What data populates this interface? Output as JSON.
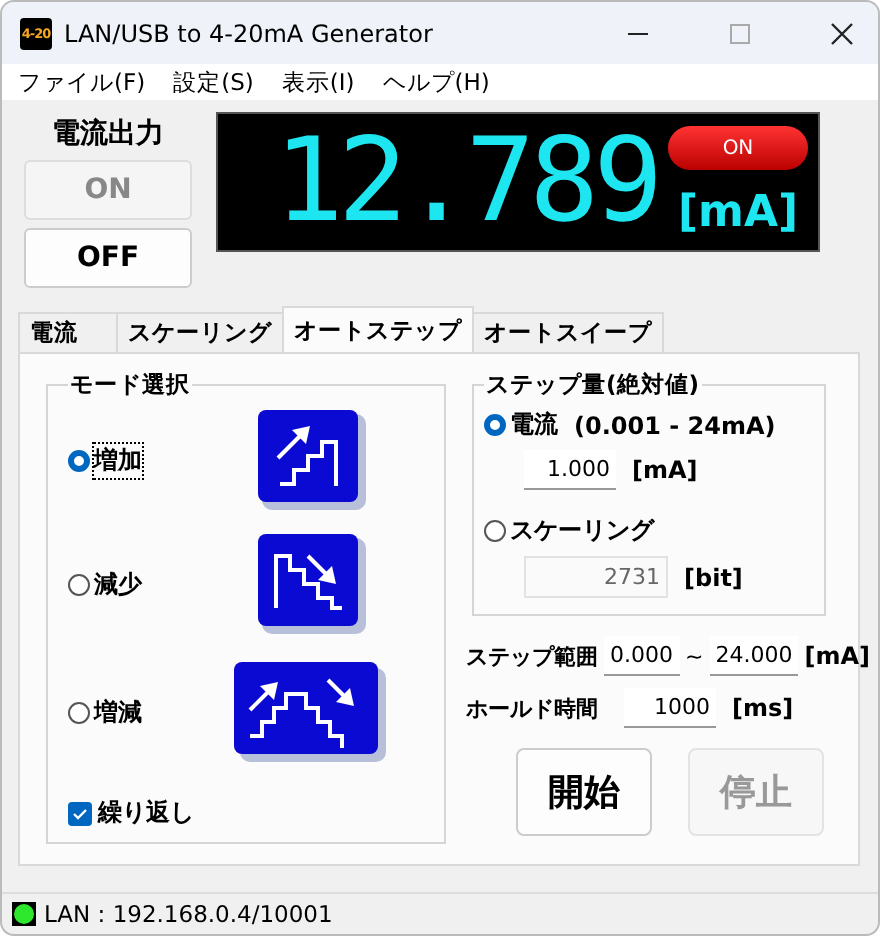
{
  "window": {
    "title": "LAN/USB to 4-20mA Generator",
    "icon_label": "4-20"
  },
  "menu": [
    "ファイル(F)",
    "設定(S)",
    "表示(I)",
    "ヘルプ(H)"
  ],
  "output": {
    "label": "電流出力",
    "on_button": {
      "label": "ON",
      "disabled": true
    },
    "off_button": {
      "label": "OFF",
      "disabled": false
    },
    "reading": "12.789",
    "unit": "[mA]",
    "indicator": {
      "label": "ON",
      "on": true
    }
  },
  "tabs": [
    {
      "label": "電流",
      "selected": false
    },
    {
      "label": "スケーリング",
      "selected": false
    },
    {
      "label": "オートステップ",
      "selected": true
    },
    {
      "label": "オートスイープ",
      "selected": false
    }
  ],
  "mode_group": {
    "title": "モード選択",
    "modes": [
      {
        "label": "増加",
        "selected": true,
        "kind": "up"
      },
      {
        "label": "減少",
        "selected": false,
        "kind": "down"
      },
      {
        "label": "増減",
        "selected": false,
        "kind": "updown"
      }
    ],
    "repeat": {
      "label": "繰り返し",
      "checked": true
    }
  },
  "step_group": {
    "title": "ステップ量(絶対値)",
    "options": [
      {
        "label": "電流",
        "range": "(0.001 - 24mA)",
        "selected": true,
        "value": "1.000",
        "unit": "[mA]",
        "disabled": false
      },
      {
        "label": "スケーリング",
        "selected": false,
        "value": "2731",
        "unit": "[bit]",
        "disabled": true
      }
    ]
  },
  "step_range": {
    "label": "ステップ範囲",
    "from": "0.000",
    "separator": "~",
    "to": "24.000",
    "unit": "[mA]"
  },
  "hold_time": {
    "label": "ホールド時間",
    "value": "1000",
    "unit": "[ms]"
  },
  "buttons": [
    {
      "label": "開始",
      "disabled": false
    },
    {
      "label": "停止",
      "disabled": true
    }
  ],
  "status_bar": {
    "text": "LAN : 192.168.0.4/10001",
    "connected": true
  }
}
